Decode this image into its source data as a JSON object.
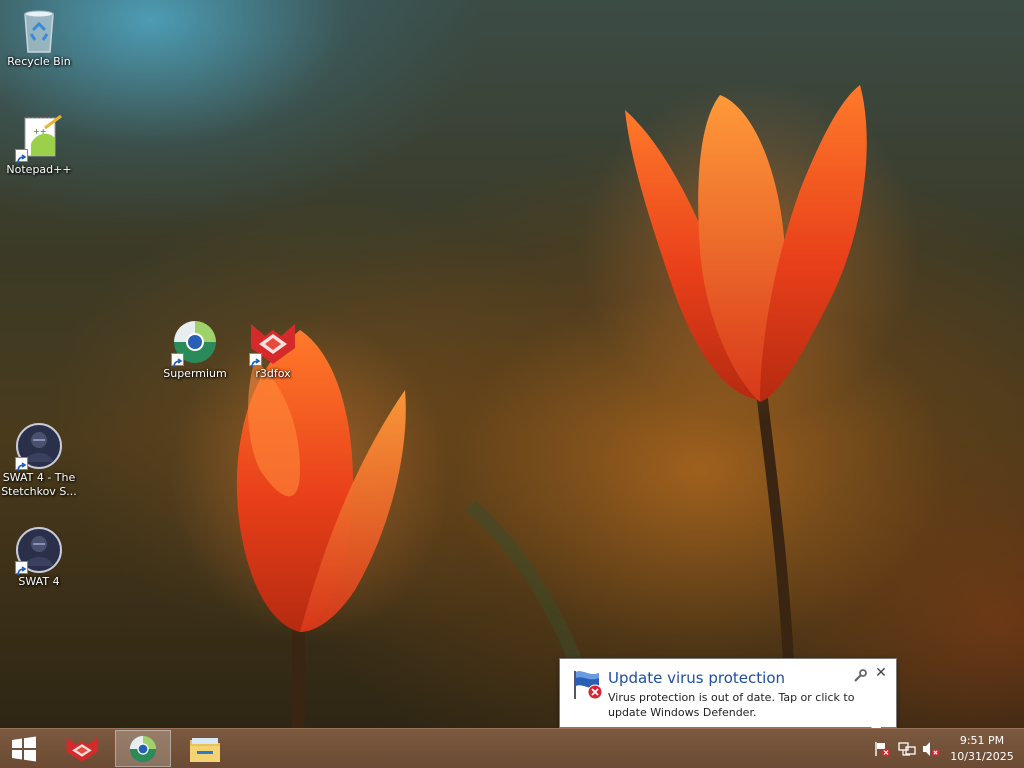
{
  "desktop": {
    "icons": [
      {
        "label": "Recycle Bin",
        "icon": "recycle-bin-icon",
        "shortcut": false
      },
      {
        "label": "Notepad++",
        "icon": "notepad-plus-plus-icon",
        "shortcut": true
      },
      {
        "label": "Supermium",
        "icon": "supermium-browser-icon",
        "shortcut": true
      },
      {
        "label": "r3dfox",
        "icon": "r3dfox-browser-icon",
        "shortcut": true
      },
      {
        "label": "SWAT 4 - The Stetchkov S...",
        "icon": "swat4-game-icon",
        "shortcut": true
      },
      {
        "label": "SWAT 4",
        "icon": "swat4-game-icon",
        "shortcut": true
      }
    ]
  },
  "notification": {
    "title": "Update virus protection",
    "body": "Virus protection is out of date. Tap or click to update Windows Defender.",
    "icon": "defender-warning-flag-icon",
    "status_color": "#d9232e"
  },
  "taskbar": {
    "start_icon": "windows-logo-icon",
    "pinned": [
      {
        "name": "r3dfox",
        "icon": "r3dfox-browser-icon",
        "active": false
      },
      {
        "name": "Supermium",
        "icon": "supermium-browser-icon",
        "active": true
      },
      {
        "name": "File Explorer",
        "icon": "folder-icon",
        "active": false
      }
    ],
    "tray": [
      {
        "name": "action-center",
        "icon": "action-center-flag-error-icon"
      },
      {
        "name": "network",
        "icon": "network-icon"
      },
      {
        "name": "volume",
        "icon": "volume-muted-icon"
      }
    ],
    "clock": {
      "time": "9:51 PM",
      "date": "10/31/2025"
    }
  },
  "colors": {
    "taskbar": "#6b4a33",
    "balloon_title": "#1d4ea2",
    "tulip": "#e8401a"
  }
}
